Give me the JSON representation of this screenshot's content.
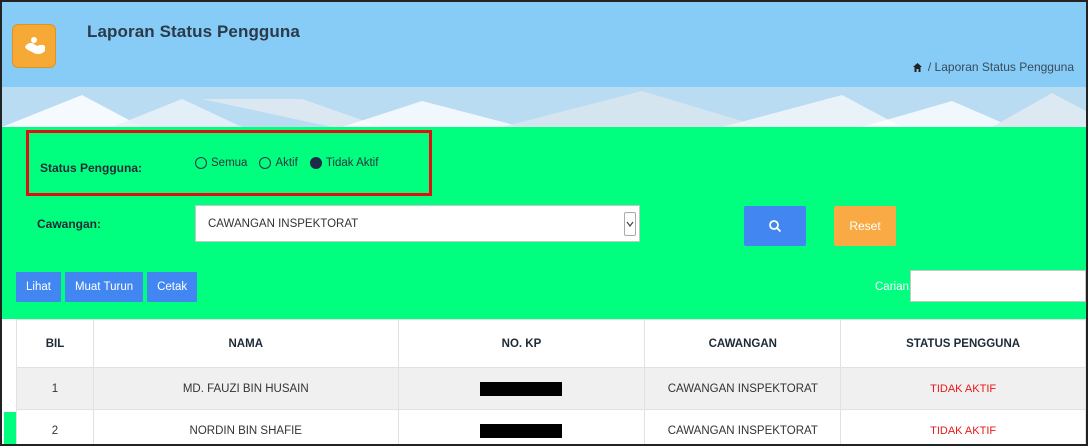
{
  "header": {
    "title": "Laporan Status Pengguna",
    "breadcrumb": "/  Laporan Status Pengguna",
    "logo_icon": "handshake-icon",
    "home_icon": "home-icon"
  },
  "filters": {
    "status_label": "Status Pengguna:",
    "options": [
      {
        "label": "Semua",
        "checked": false
      },
      {
        "label": "Aktif",
        "checked": false
      },
      {
        "label": "Tidak Aktif",
        "checked": true
      }
    ],
    "cawangan_label": "Cawangan:",
    "cawangan_value": "CAWANGAN INSPEKTORAT",
    "reset_label": "Reset"
  },
  "actions": {
    "lihat": "Lihat",
    "muat_turun": "Muat Turun",
    "cetak": "Cetak",
    "carian_label": "Carian:"
  },
  "table": {
    "columns": [
      "BIL",
      "NAMA",
      "NO. KP",
      "CAWANGAN",
      "STATUS PENGGUNA"
    ],
    "rows": [
      {
        "bil": "1",
        "nama": "MD. FAUZI BIN HUSAIN",
        "cawangan": "CAWANGAN INSPEKTORAT",
        "status": "TIDAK AKTIF"
      },
      {
        "bil": "2",
        "nama": "NORDIN BIN SHAFIE",
        "cawangan": "CAWANGAN INSPEKTORAT",
        "status": "TIDAK AKTIF"
      }
    ]
  },
  "colors": {
    "header_bg": "#86ccf6",
    "panel_bg": "#00ff7f",
    "primary_button": "#4186f1",
    "reset_button": "#f9aa44",
    "status_inactive": "#e71818",
    "highlight_border": "#e01010"
  }
}
